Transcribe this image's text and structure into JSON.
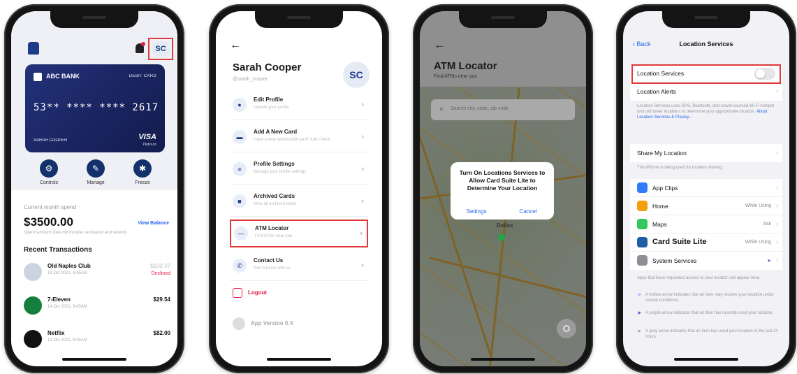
{
  "colors": {
    "highlight": "#e03a3a",
    "brand": "#1e3a8a",
    "link": "#2563eb",
    "danger": "#e11d48"
  },
  "phone1": {
    "avatar_initials": "SC",
    "card": {
      "bank_name": "ABC BANK",
      "card_type": "DEBIT CARD",
      "number": "53** **** **** 2617",
      "holder": "SARAH COOPER",
      "network": "VISA",
      "network_sub": "Platinum"
    },
    "actions": [
      {
        "label": "Controls",
        "icon": "gear-icon"
      },
      {
        "label": "Manage",
        "icon": "wrench-icon"
      },
      {
        "label": "Freeze",
        "icon": "snowflake-icon"
      }
    ],
    "spend_label": "Current month spend",
    "spend_amount": "$3500.00",
    "view_balance": "View Balance",
    "spend_note": "Spend amount does not include cashbacks and refunds",
    "recent_title": "Recent Transactions",
    "transactions": [
      {
        "name": "Old Naples Club",
        "date": "14 Oct 2021, 9:45AM",
        "amount": "$100.37",
        "status": "Declined"
      },
      {
        "name": "7-Eleven",
        "date": "14 Oct 2021, 9:45AM",
        "amount": "$29.54",
        "status": ""
      },
      {
        "name": "Netflix",
        "date": "13 Oct 2021, 9:45AM",
        "amount": "$82.00",
        "status": ""
      }
    ]
  },
  "phone2": {
    "back": "←",
    "name": "Sarah Cooper",
    "handle": "@sarah_cooper",
    "avatar_initials": "SC",
    "menu": [
      {
        "title": "Edit Profile",
        "sub": "Update your profile",
        "icon": "person-icon"
      },
      {
        "title": "Add A New Card",
        "sub": "Have a new debit/credit card? Add it here",
        "icon": "card-icon"
      },
      {
        "title": "Profile Settings",
        "sub": "Manage your profile settings",
        "icon": "sliders-icon"
      },
      {
        "title": "Archived Cards",
        "sub": "View all archived cards",
        "icon": "archive-icon"
      },
      {
        "title": "ATM Locator",
        "sub": "Find ATMs near you",
        "icon": "atm-icon"
      },
      {
        "title": "Contact Us",
        "sub": "Get in touch with us",
        "icon": "phone-icon"
      }
    ],
    "logout": "Logout",
    "app_version": "App Version 0.X"
  },
  "phone3": {
    "back": "←",
    "title": "ATM Locator",
    "subtitle": "Find ATMs near you",
    "search_placeholder": "Search city, state, zip code",
    "dialog": {
      "message": "Turn On Locations Services to Allow Card Suite Lite to Determine Your Location",
      "settings": "Settings",
      "cancel": "Cancel"
    },
    "map_label": "Dallas"
  },
  "phone4": {
    "back": "Back",
    "title": "Location Services",
    "location_services": "Location Services",
    "location_alerts": "Location Alerts",
    "info_text": "Location Services uses GPS, Bluetooth, and crowd-sourced Wi-Fi hotspot and cell tower locations to determine your approximate location.",
    "info_link": "About Location Services & Privacy...",
    "share_my_location": "Share My Location",
    "share_note": "This iPhone is being used for location sharing.",
    "apps": [
      {
        "name": "App Clips",
        "value": "",
        "icon_color": "#2f7cf6"
      },
      {
        "name": "Home",
        "value": "While Using",
        "icon_color": "#f59e0b"
      },
      {
        "name": "Maps",
        "value": "Ask",
        "icon_color": "#34c759"
      },
      {
        "name": "Card Suite Lite",
        "value": "While Using",
        "icon_color": "#1e5fa8"
      },
      {
        "name": "System Services",
        "value": "",
        "icon_color": "#8e8e93"
      }
    ],
    "apps_note": "Apps that have requested access to your location will appear here.",
    "legend": [
      {
        "text": "A hollow arrow indicates that an item may receive your location under certain conditions.",
        "color": "#a855f7"
      },
      {
        "text": "A purple arrow indicates that an item has recently used your location.",
        "color": "#7c3aed"
      },
      {
        "text": "A gray arrow indicates that an item has used your location in the last 24 hours.",
        "color": "#9ca3af"
      }
    ]
  }
}
